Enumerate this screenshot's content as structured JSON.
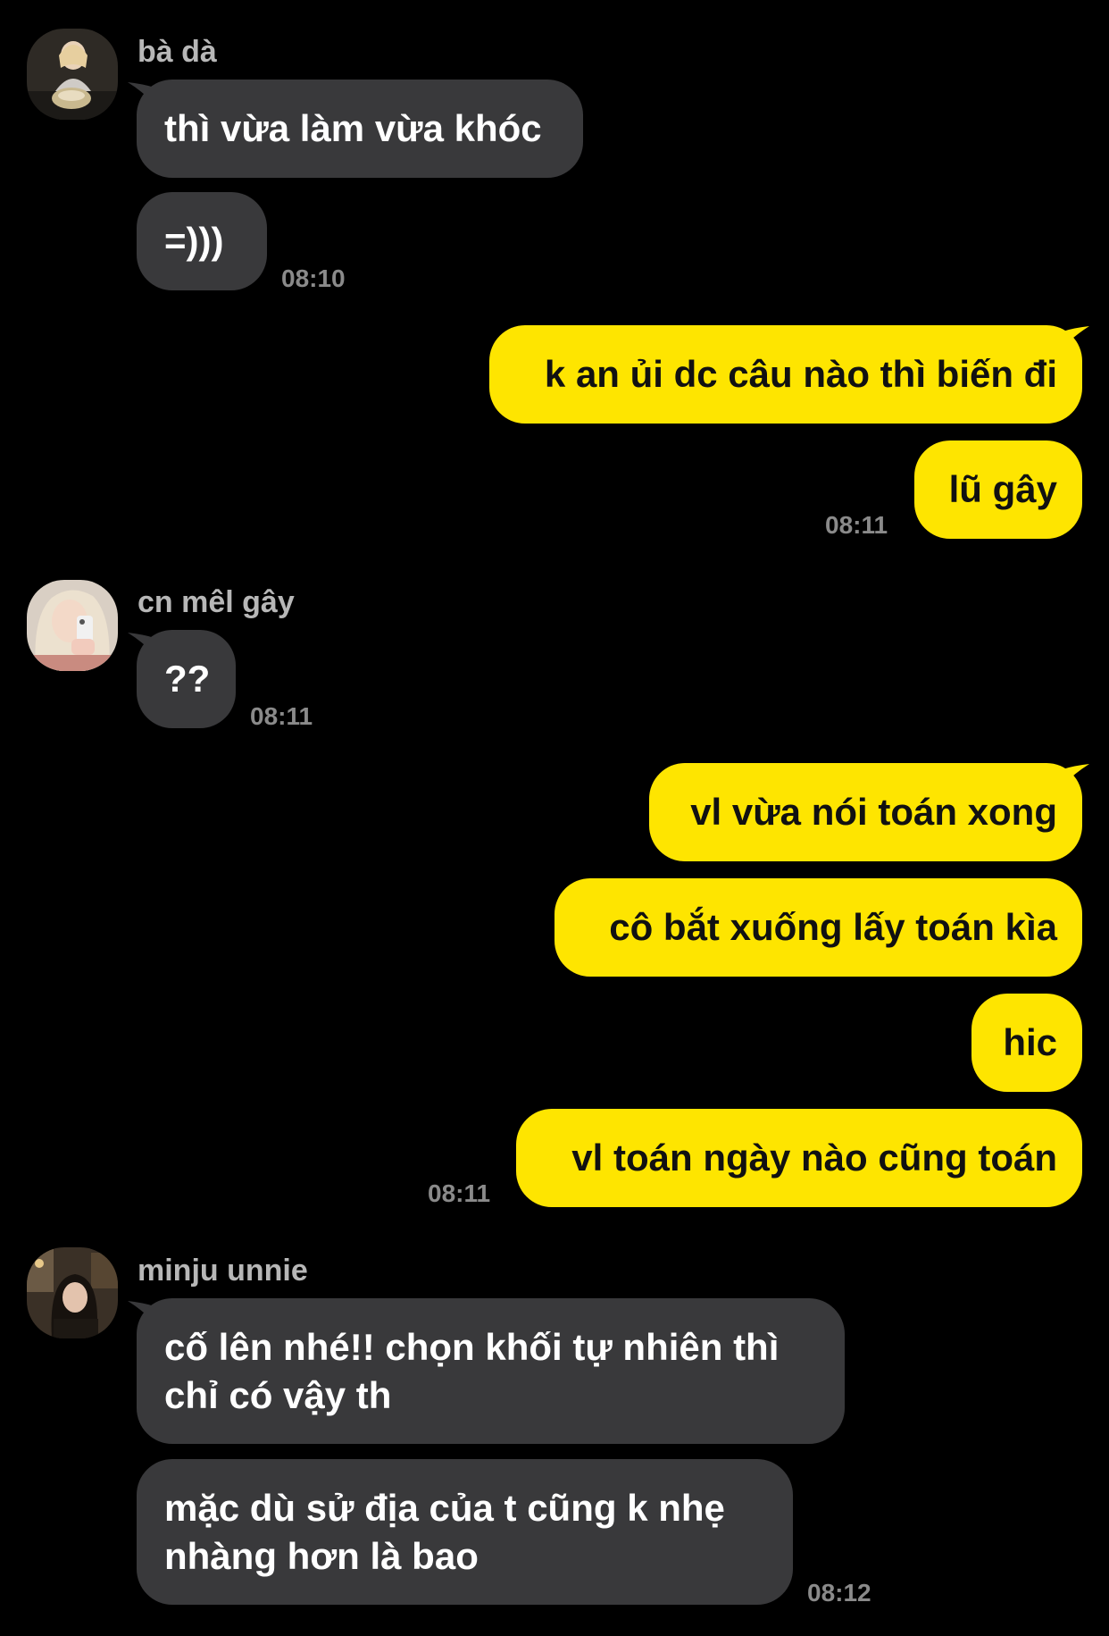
{
  "colors": {
    "background": "#000000",
    "incoming_bubble": "#39393b",
    "outgoing_bubble": "#fee500",
    "sender_name": "#b7b7b7",
    "timestamp": "#8a8a8a"
  },
  "groups": [
    {
      "sender": "bà dà",
      "avatar": "avatar-photo",
      "messages": [
        "thì vừa làm vừa khóc",
        "=)))"
      ],
      "time": "08:10"
    },
    {
      "sender": "me",
      "messages": [
        "k an ủi dc câu nào thì biến đi",
        "lũ gây"
      ],
      "time": "08:11"
    },
    {
      "sender": "cn mêl gây",
      "avatar": "avatar-photo",
      "messages": [
        "??"
      ],
      "time": "08:11"
    },
    {
      "sender": "me",
      "messages": [
        "vl vừa nói toán xong",
        "cô bắt xuống lấy toán kìa",
        "hic",
        "vl toán ngày nào cũng toán"
      ],
      "time": "08:11"
    },
    {
      "sender": "minju unnie",
      "avatar": "avatar-photo",
      "messages": [
        "cố lên nhé!! chọn khối tự nhiên thì chỉ có vậy th",
        "mặc dù sử địa của t cũng k nhẹ nhàng hơn là bao"
      ],
      "time": "08:12"
    }
  ]
}
